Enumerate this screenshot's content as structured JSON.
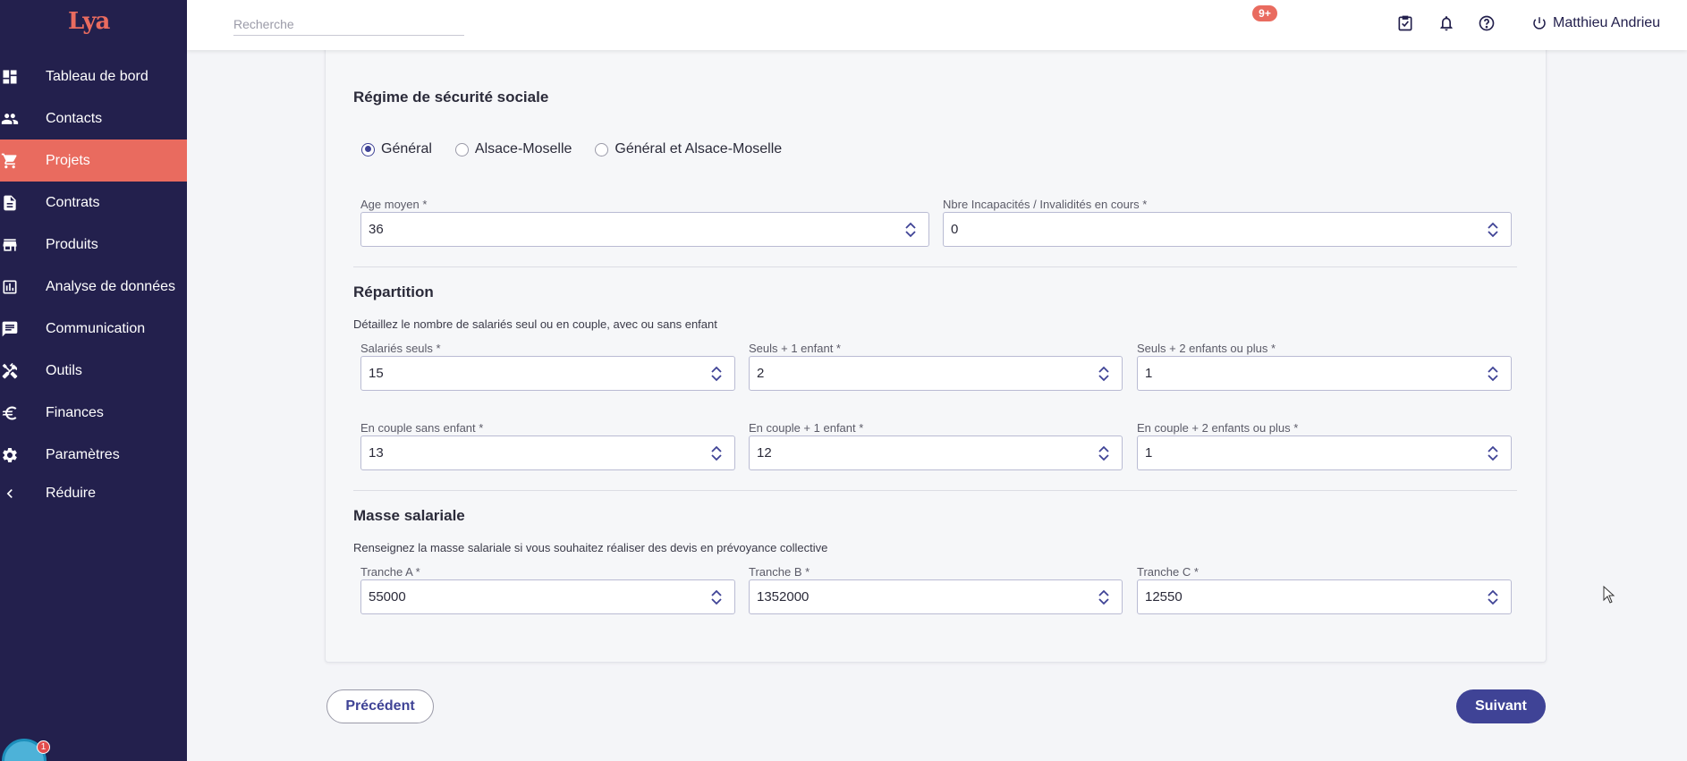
{
  "sidebar": {
    "logo": "Lya",
    "items": [
      {
        "label": "Tableau de bord",
        "icon": "dashboard-icon"
      },
      {
        "label": "Contacts",
        "icon": "people-icon"
      },
      {
        "label": "Projets",
        "icon": "cart-icon",
        "active": true
      },
      {
        "label": "Contrats",
        "icon": "document-icon"
      },
      {
        "label": "Produits",
        "icon": "store-icon"
      },
      {
        "label": "Analyse de données",
        "icon": "chart-icon"
      },
      {
        "label": "Communication",
        "icon": "chat-icon"
      },
      {
        "label": "Outils",
        "icon": "tools-icon"
      },
      {
        "label": "Finances",
        "icon": "euro-icon"
      },
      {
        "label": "Paramètres",
        "icon": "gear-icon"
      },
      {
        "label": "Réduire",
        "icon": "chevron-left-icon"
      }
    ],
    "chat_badge": "1"
  },
  "header": {
    "search_placeholder": "Recherche",
    "notif_badge": "9+",
    "user_name": "Matthieu Andrieu"
  },
  "securite": {
    "title": "Régime de sécurité sociale",
    "options": [
      "Général",
      "Alsace-Moselle",
      "Général et Alsace-Moselle"
    ],
    "selected": "Général"
  },
  "fields_top": {
    "age_label": "Age moyen *",
    "age_value": "36",
    "incap_label": "Nbre Incapacités / Invalidités en cours *",
    "incap_value": "0"
  },
  "repartition": {
    "title": "Répartition",
    "desc": "Détaillez le nombre de salariés seul ou en couple, avec ou sans enfant",
    "fields": [
      {
        "label": "Salariés seuls *",
        "value": "15"
      },
      {
        "label": "Seuls + 1 enfant *",
        "value": "2"
      },
      {
        "label": "Seuls + 2 enfants ou plus *",
        "value": "1"
      },
      {
        "label": "En couple sans enfant *",
        "value": "13"
      },
      {
        "label": "En couple + 1 enfant *",
        "value": "12"
      },
      {
        "label": "En couple + 2 enfants ou plus *",
        "value": "1"
      }
    ]
  },
  "masse": {
    "title": "Masse salariale",
    "desc": "Renseignez la masse salariale si vous souhaitez réaliser des devis en prévoyance collective",
    "fields": [
      {
        "label": "Tranche A *",
        "value": "55000"
      },
      {
        "label": "Tranche B *",
        "value": "1352000"
      },
      {
        "label": "Tranche C *",
        "value": "12550"
      }
    ]
  },
  "buttons": {
    "prev": "Précédent",
    "next": "Suivant"
  },
  "colors": {
    "sidebar_bg": "#23204d",
    "accent": "#e96b5f",
    "primary": "#3f4396"
  }
}
